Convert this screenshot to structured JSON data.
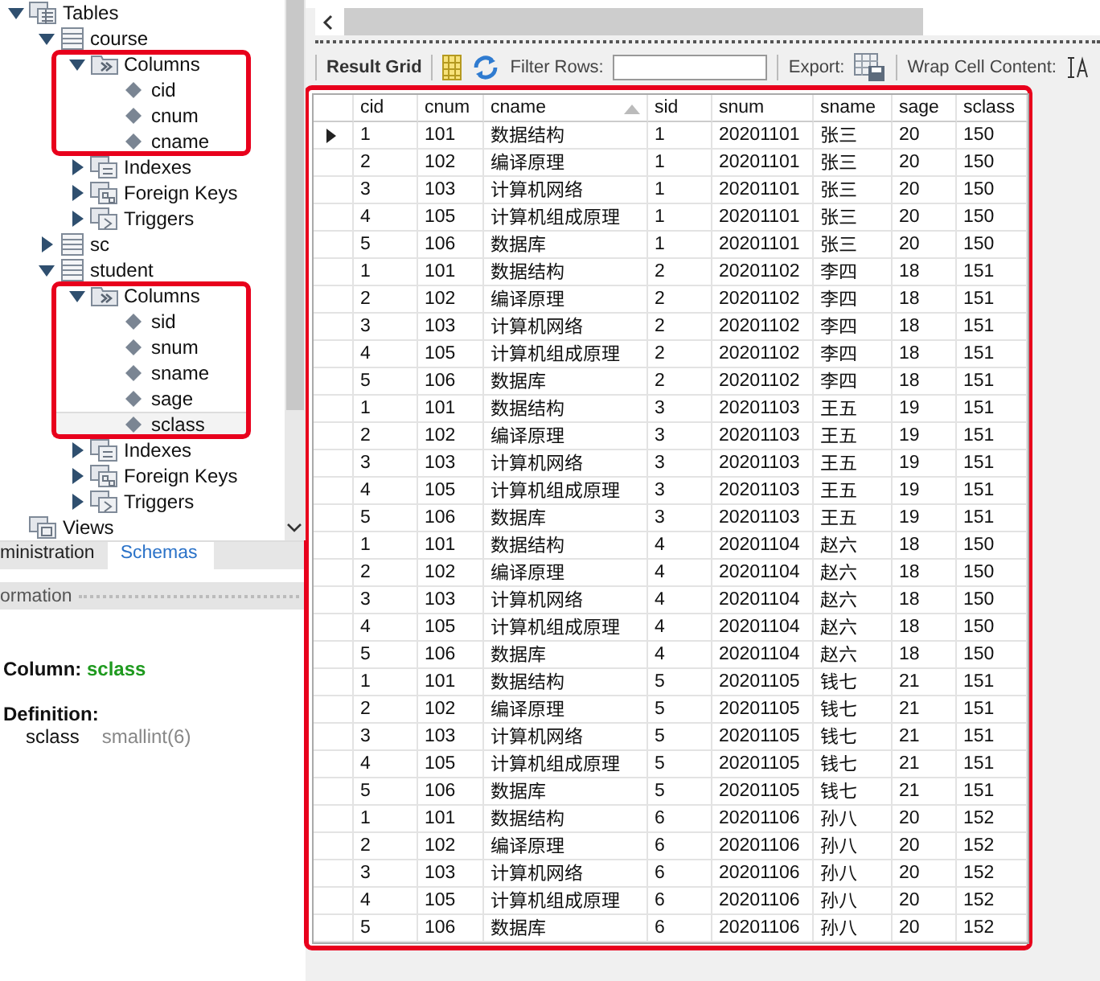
{
  "tree": [
    {
      "label": "Tables",
      "kind": "folder",
      "expanded": true,
      "selected": false,
      "children": [
        {
          "label": "course",
          "kind": "table",
          "expanded": true,
          "selected": false,
          "children": [
            {
              "label": "Columns",
              "kind": "columns",
              "expanded": true,
              "highlighted": true,
              "selected": false,
              "children": [
                {
                  "label": "cid",
                  "kind": "column",
                  "selected": false
                },
                {
                  "label": "cnum",
                  "kind": "column",
                  "selected": false
                },
                {
                  "label": "cname",
                  "kind": "column",
                  "selected": false
                }
              ]
            },
            {
              "label": "Indexes",
              "kind": "indexes",
              "expanded": false,
              "selected": false
            },
            {
              "label": "Foreign Keys",
              "kind": "keys",
              "expanded": false,
              "selected": false
            },
            {
              "label": "Triggers",
              "kind": "triggers",
              "expanded": false,
              "selected": false
            }
          ]
        },
        {
          "label": "sc",
          "kind": "table",
          "expanded": false,
          "selected": false
        },
        {
          "label": "student",
          "kind": "table",
          "expanded": true,
          "selected": false,
          "children": [
            {
              "label": "Columns",
              "kind": "columns",
              "expanded": true,
              "highlighted": true,
              "selected": false,
              "children": [
                {
                  "label": "sid",
                  "kind": "column",
                  "selected": false
                },
                {
                  "label": "snum",
                  "kind": "column",
                  "selected": false
                },
                {
                  "label": "sname",
                  "kind": "column",
                  "selected": false
                },
                {
                  "label": "sage",
                  "kind": "column",
                  "selected": false
                },
                {
                  "label": "sclass",
                  "kind": "column",
                  "selected": true
                }
              ]
            },
            {
              "label": "Indexes",
              "kind": "indexes",
              "expanded": false,
              "selected": false
            },
            {
              "label": "Foreign Keys",
              "kind": "keys",
              "expanded": false,
              "selected": false
            },
            {
              "label": "Triggers",
              "kind": "triggers",
              "expanded": false,
              "selected": false
            }
          ]
        }
      ]
    },
    {
      "label": "Views",
      "kind": "views",
      "selected": false
    }
  ],
  "tabs": [
    {
      "label": "ministration",
      "selected": false
    },
    {
      "label": "Schemas",
      "selected": true
    }
  ],
  "info_panel": {
    "title": "ormation",
    "column_label": "Column:",
    "column_name": "sclass",
    "definition_label": "Definition:",
    "definition_name": "sclass",
    "definition_type": "smallint(6)"
  },
  "toolbar": {
    "result_grid": "Result Grid",
    "filter_label": "Filter Rows:",
    "export_label": "Export:",
    "wrap_label": "Wrap Cell Content:"
  },
  "grid": {
    "columns": [
      {
        "label": "cid",
        "sorted": false
      },
      {
        "label": "cnum",
        "sorted": false
      },
      {
        "label": "cname",
        "sorted": true
      },
      {
        "label": "sid",
        "sorted": false
      },
      {
        "label": "snum",
        "sorted": false
      },
      {
        "label": "sname",
        "sorted": false
      },
      {
        "label": "sage",
        "sorted": false
      },
      {
        "label": "sclass",
        "sorted": false
      }
    ],
    "rows": [
      {
        "selected": true,
        "cells": [
          "1",
          "101",
          "数据结构",
          "1",
          "20201101",
          "张三",
          "20",
          "150"
        ]
      },
      {
        "selected": false,
        "cells": [
          "2",
          "102",
          "编译原理",
          "1",
          "20201101",
          "张三",
          "20",
          "150"
        ]
      },
      {
        "selected": false,
        "cells": [
          "3",
          "103",
          "计算机网络",
          "1",
          "20201101",
          "张三",
          "20",
          "150"
        ]
      },
      {
        "selected": false,
        "cells": [
          "4",
          "105",
          "计算机组成原理",
          "1",
          "20201101",
          "张三",
          "20",
          "150"
        ]
      },
      {
        "selected": false,
        "cells": [
          "5",
          "106",
          "数据库",
          "1",
          "20201101",
          "张三",
          "20",
          "150"
        ]
      },
      {
        "selected": false,
        "cells": [
          "1",
          "101",
          "数据结构",
          "2",
          "20201102",
          "李四",
          "18",
          "151"
        ]
      },
      {
        "selected": false,
        "cells": [
          "2",
          "102",
          "编译原理",
          "2",
          "20201102",
          "李四",
          "18",
          "151"
        ]
      },
      {
        "selected": false,
        "cells": [
          "3",
          "103",
          "计算机网络",
          "2",
          "20201102",
          "李四",
          "18",
          "151"
        ]
      },
      {
        "selected": false,
        "cells": [
          "4",
          "105",
          "计算机组成原理",
          "2",
          "20201102",
          "李四",
          "18",
          "151"
        ]
      },
      {
        "selected": false,
        "cells": [
          "5",
          "106",
          "数据库",
          "2",
          "20201102",
          "李四",
          "18",
          "151"
        ]
      },
      {
        "selected": false,
        "cells": [
          "1",
          "101",
          "数据结构",
          "3",
          "20201103",
          "王五",
          "19",
          "151"
        ]
      },
      {
        "selected": false,
        "cells": [
          "2",
          "102",
          "编译原理",
          "3",
          "20201103",
          "王五",
          "19",
          "151"
        ]
      },
      {
        "selected": false,
        "cells": [
          "3",
          "103",
          "计算机网络",
          "3",
          "20201103",
          "王五",
          "19",
          "151"
        ]
      },
      {
        "selected": false,
        "cells": [
          "4",
          "105",
          "计算机组成原理",
          "3",
          "20201103",
          "王五",
          "19",
          "151"
        ]
      },
      {
        "selected": false,
        "cells": [
          "5",
          "106",
          "数据库",
          "3",
          "20201103",
          "王五",
          "19",
          "151"
        ]
      },
      {
        "selected": false,
        "cells": [
          "1",
          "101",
          "数据结构",
          "4",
          "20201104",
          "赵六",
          "18",
          "150"
        ]
      },
      {
        "selected": false,
        "cells": [
          "2",
          "102",
          "编译原理",
          "4",
          "20201104",
          "赵六",
          "18",
          "150"
        ]
      },
      {
        "selected": false,
        "cells": [
          "3",
          "103",
          "计算机网络",
          "4",
          "20201104",
          "赵六",
          "18",
          "150"
        ]
      },
      {
        "selected": false,
        "cells": [
          "4",
          "105",
          "计算机组成原理",
          "4",
          "20201104",
          "赵六",
          "18",
          "150"
        ]
      },
      {
        "selected": false,
        "cells": [
          "5",
          "106",
          "数据库",
          "4",
          "20201104",
          "赵六",
          "18",
          "150"
        ]
      },
      {
        "selected": false,
        "cells": [
          "1",
          "101",
          "数据结构",
          "5",
          "20201105",
          "钱七",
          "21",
          "151"
        ]
      },
      {
        "selected": false,
        "cells": [
          "2",
          "102",
          "编译原理",
          "5",
          "20201105",
          "钱七",
          "21",
          "151"
        ]
      },
      {
        "selected": false,
        "cells": [
          "3",
          "103",
          "计算机网络",
          "5",
          "20201105",
          "钱七",
          "21",
          "151"
        ]
      },
      {
        "selected": false,
        "cells": [
          "4",
          "105",
          "计算机组成原理",
          "5",
          "20201105",
          "钱七",
          "21",
          "151"
        ]
      },
      {
        "selected": false,
        "cells": [
          "5",
          "106",
          "数据库",
          "5",
          "20201105",
          "钱七",
          "21",
          "151"
        ]
      },
      {
        "selected": false,
        "cells": [
          "1",
          "101",
          "数据结构",
          "6",
          "20201106",
          "孙八",
          "20",
          "152"
        ]
      },
      {
        "selected": false,
        "cells": [
          "2",
          "102",
          "编译原理",
          "6",
          "20201106",
          "孙八",
          "20",
          "152"
        ]
      },
      {
        "selected": false,
        "cells": [
          "3",
          "103",
          "计算机网络",
          "6",
          "20201106",
          "孙八",
          "20",
          "152"
        ]
      },
      {
        "selected": false,
        "cells": [
          "4",
          "105",
          "计算机组成原理",
          "6",
          "20201106",
          "孙八",
          "20",
          "152"
        ]
      },
      {
        "selected": false,
        "cells": [
          "5",
          "106",
          "数据库",
          "6",
          "20201106",
          "孙八",
          "20",
          "152"
        ]
      }
    ]
  }
}
